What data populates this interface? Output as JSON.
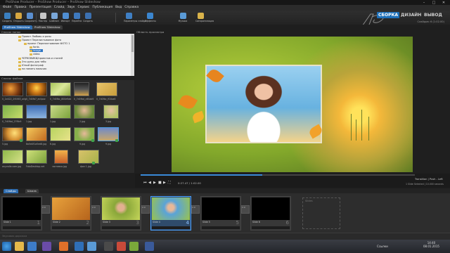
{
  "window": {
    "title": "ProShow Producer – ProShow Producer – ProShow Slideshow",
    "minimize": "–",
    "maximize": "□",
    "close": "✕"
  },
  "menu": [
    "Файл",
    "Правка",
    "Презентация",
    "Слайд",
    "Звук",
    "Сервис",
    "Публикация",
    "Вид",
    "Справка"
  ],
  "toolbar": {
    "buttons": [
      "Создать",
      "Открыть",
      "Сохранить",
      "Мастер",
      "Шаблон",
      "Импорт",
      "Перейти",
      "Создать",
      "Параметры слайда",
      "Эффекты",
      "Музыка",
      "Синхронизация"
    ],
    "brand_tabs": [
      "СБОРКА",
      "ДИЗАЙН",
      "ВЫВОД"
    ],
    "slides_info": "Слайдов: 6 (1:02.00)"
  },
  "doc_tabs": [
    "ProShow Slideshow",
    "ProShow Slideshow"
  ],
  "left": {
    "folders_header": "Список папок",
    "files_header": "Список файлов",
    "tree": [
      "Проект Любовь и розы",
      "Проект Перелистывание фото",
      "проект Перелистывание ФОТО 1",
      "fonts",
      "image",
      "video",
      "ЧЕРНОВИКИ/проектов и стилей",
      "Это руны для тебя",
      "Юный фотограф",
      "на память мальчик"
    ],
    "thumbs": [
      "0_1e422_2f4563_orig",
      "0_7d0fb7_eclipse",
      "0_7d0fbc_800e9ab",
      "0_7d0fbd_c60ab9",
      "0_7d0fbc_f01ba6",
      "0_7d0fbd_27f6c9",
      "1.jpg",
      "1.jpg",
      "2.jpg",
      "3.jpg",
      "5.jpg",
      "5.jpg",
      "6.jpg",
      "8a5d4f1a5ed8.jpg",
      "9.jpg",
      "9.jpg",
      "anyvalle.com.jpg",
      "FotoDesktop.net",
      "заставка.jpg",
      "фон 1.jpg"
    ]
  },
  "preview": {
    "header": "Область просмотра",
    "time": "0:27.47 / 1:02.00",
    "transition": "Transition | Push - Left",
    "selected": "1 Slide Selected | 10.000 seconds"
  },
  "timeline": {
    "tabs": [
      "Слайды",
      "Шкала"
    ],
    "slides": [
      {
        "label": "Slide 1",
        "num": "1"
      },
      {
        "label": "Slide 2",
        "num": "2"
      },
      {
        "label": "Slide 3",
        "num": "3"
      },
      {
        "label": "Slide 4",
        "num": "4"
      },
      {
        "label": "Slide 5",
        "num": "5"
      },
      {
        "label": "Slide 6",
        "num": "6"
      }
    ],
    "trans_labels": [
      "2.0",
      "2.0",
      "2.0",
      "2.0",
      "2.0"
    ],
    "placeholder": "Slides",
    "music_strip": "Звуковая дорожка"
  },
  "taskbar": {
    "lang": "Ссылки",
    "time": "14:40",
    "date": "08.01.2015"
  },
  "colors": {
    "accent": "#2f6db0",
    "selection": "#4aa0ff",
    "folder": "#e0b94a"
  }
}
